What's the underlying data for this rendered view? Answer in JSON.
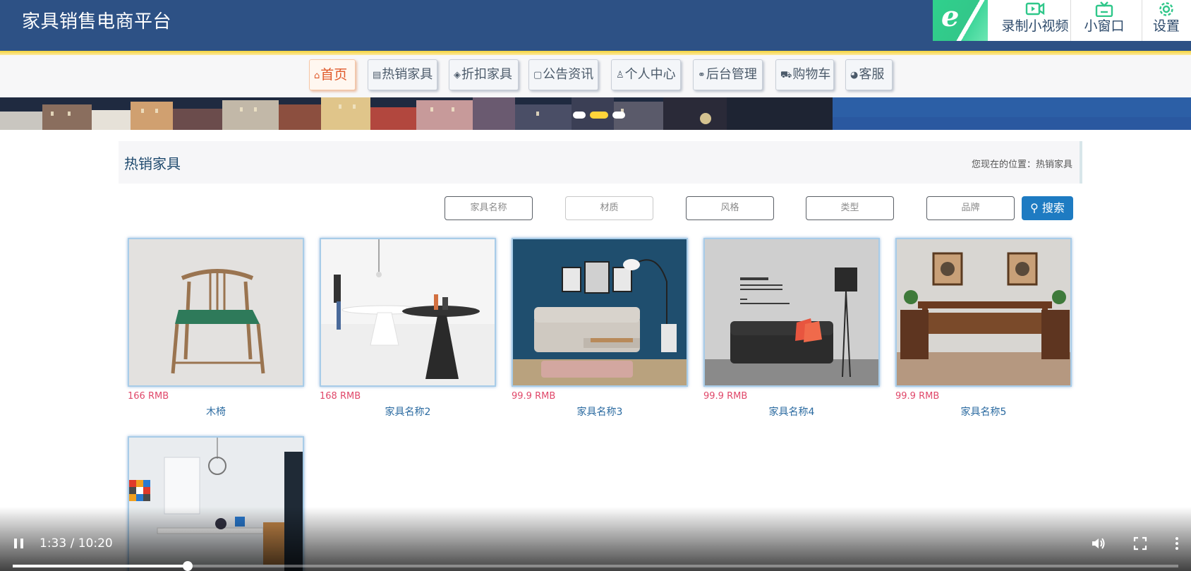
{
  "header": {
    "title": "家具销售电商平台"
  },
  "ext_toolbar": {
    "logo": "e",
    "record_label": "录制小视频",
    "mini_window_label": "小窗口",
    "settings_label": "设置"
  },
  "nav": {
    "items": [
      {
        "icon": "⌂",
        "label": "首页",
        "active": true
      },
      {
        "icon": "▤",
        "label": "热销家具"
      },
      {
        "icon": "◈",
        "label": "折扣家具"
      },
      {
        "icon": "▢",
        "label": "公告资讯"
      },
      {
        "icon": "♙",
        "label": "个人中心"
      },
      {
        "icon": "⚭",
        "label": "后台管理"
      },
      {
        "icon": "⛟",
        "label": "购物车"
      },
      {
        "icon": "◕",
        "label": "客服"
      }
    ]
  },
  "banner": {
    "dots": 3,
    "active_dot": 1
  },
  "section": {
    "title": "热销家具",
    "location": "您现在的位置：热销家具"
  },
  "filters": {
    "name_placeholder": "家具名称",
    "material_placeholder": "材质",
    "style_placeholder": "风格",
    "type_placeholder": "类型",
    "brand_placeholder": "品牌",
    "search_label": "搜索"
  },
  "products": [
    {
      "price": "166 RMB",
      "name": "木椅"
    },
    {
      "price": "168 RMB",
      "name": "家具名称2"
    },
    {
      "price": "99.9 RMB",
      "name": "家具名称3"
    },
    {
      "price": "99.9 RMB",
      "name": "家具名称4"
    },
    {
      "price": "99.9 RMB",
      "name": "家具名称5"
    },
    {
      "price": "",
      "name": ""
    }
  ],
  "video": {
    "current_time": "1:33",
    "duration": "10:20",
    "time_display": "1:33 / 10:20",
    "progress_fraction": 0.15
  }
}
